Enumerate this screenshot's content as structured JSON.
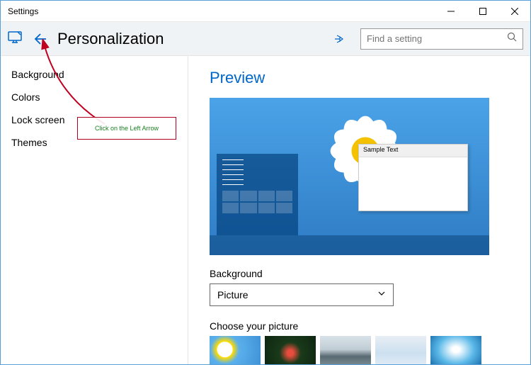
{
  "window": {
    "title": "Settings"
  },
  "header": {
    "page_title": "Personalization",
    "search_placeholder": "Find a setting"
  },
  "sidebar": {
    "items": [
      {
        "label": "Background"
      },
      {
        "label": "Colors"
      },
      {
        "label": "Lock screen"
      },
      {
        "label": "Themes"
      }
    ]
  },
  "content": {
    "preview_title": "Preview",
    "preview_window_text": "Sample Text",
    "background_label": "Background",
    "background_value": "Picture",
    "choose_picture_label": "Choose your picture"
  },
  "annotation": {
    "text": "Click on the Left Arrow"
  }
}
